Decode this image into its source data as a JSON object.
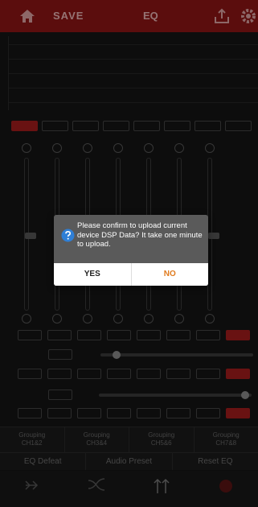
{
  "header": {
    "save_label": "SAVE",
    "title": "EQ",
    "accent": "#8c1414"
  },
  "channels": {
    "active_color": "#a11d1d"
  },
  "bottom": {
    "groups": [
      {
        "line1": "Grouping",
        "line2": "CH1&2"
      },
      {
        "line1": "Grouping",
        "line2": "CH3&4"
      },
      {
        "line1": "Grouping",
        "line2": "CH5&6"
      },
      {
        "line1": "Grouping",
        "line2": "CH7&8"
      }
    ],
    "eq_default": "EQ Defeat",
    "audio_preset": "Audio Preset",
    "reset_eq": "Reset EQ"
  },
  "dialog": {
    "message": "Please confirm to upload current device DSP Data? It take one minute to upload.",
    "yes_label": "YES",
    "no_label": "NO",
    "no_color": "#e07b1e",
    "icon": "question-icon"
  }
}
